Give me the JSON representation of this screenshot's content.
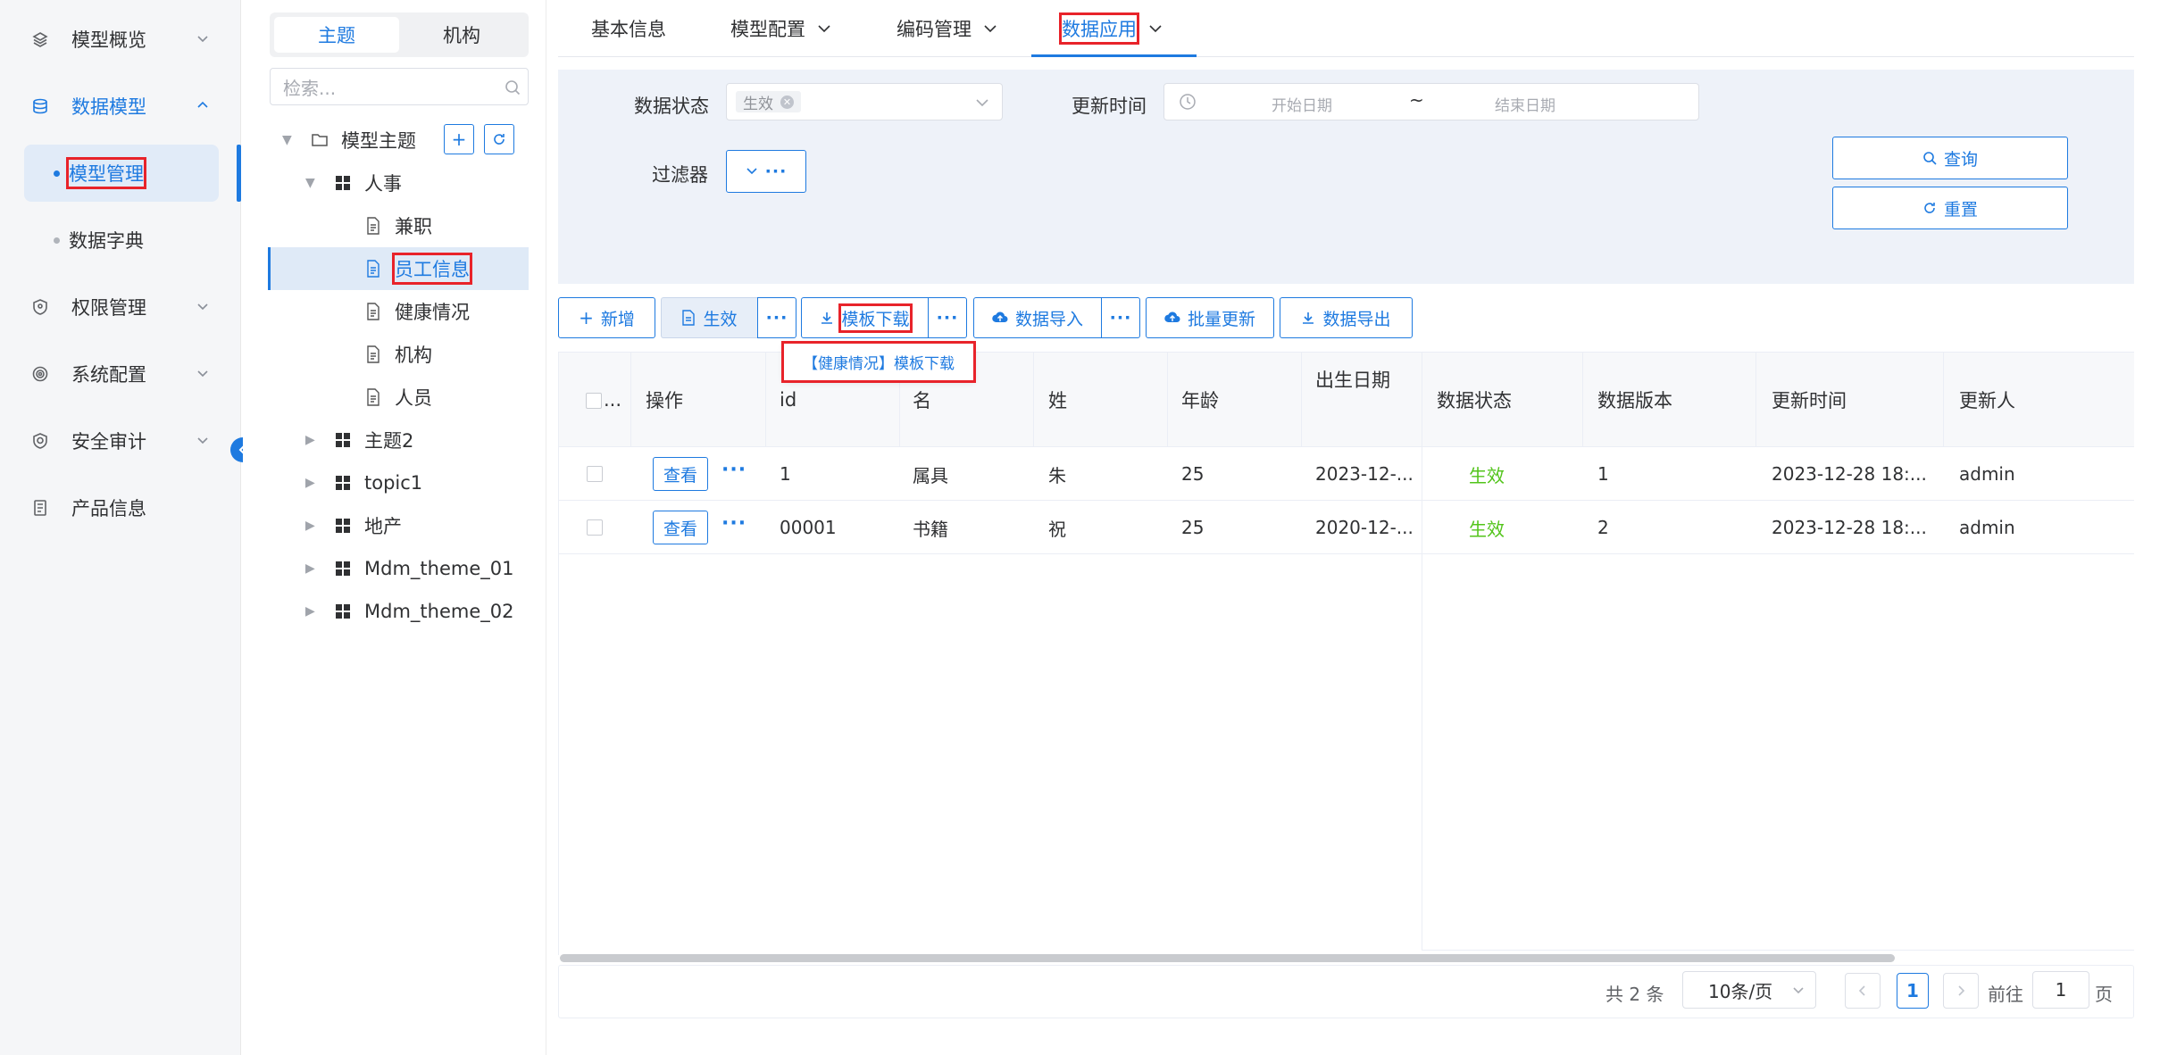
{
  "sidebar": {
    "items": [
      {
        "label": "模型概览",
        "icon": "layers-icon"
      },
      {
        "label": "数据模型",
        "icon": "database-icon"
      },
      {
        "label": "权限管理",
        "icon": "shield-icon"
      },
      {
        "label": "系统配置",
        "icon": "settings-icon"
      },
      {
        "label": "安全审计",
        "icon": "shield-check-icon"
      },
      {
        "label": "产品信息",
        "icon": "document-icon"
      }
    ],
    "subitems": [
      {
        "label": "模型管理"
      },
      {
        "label": "数据字典"
      }
    ]
  },
  "tree": {
    "tabs": [
      "主题",
      "机构"
    ],
    "search_placeholder": "检索...",
    "root": "模型主题",
    "nodes": {
      "renshi": "人事",
      "jianzhi": "兼职",
      "yuangong": "员工信息",
      "jiankang": "健康情况",
      "jigou": "机构",
      "renyuan": "人员",
      "zhuti2": "主题2",
      "topic1": "topic1",
      "dichan": "地产",
      "mdm1": "Mdm_theme_01",
      "mdm2": "Mdm_theme_02"
    }
  },
  "top_tabs": [
    "基本信息",
    "模型配置",
    "编码管理",
    "数据应用"
  ],
  "filter": {
    "status_label": "数据状态",
    "status_tag": "生效",
    "time_label": "更新时间",
    "start_placeholder": "开始日期",
    "range_sep": "~",
    "end_placeholder": "结束日期",
    "filter_label": "过滤器",
    "query_btn": "查询",
    "reset_btn": "重置"
  },
  "toolbar": {
    "add": "新增",
    "activate": "生效",
    "template_download": "模板下载",
    "import": "数据导入",
    "batch_update": "批量更新",
    "export": "数据导出",
    "tooltip": "【健康情况】模板下载"
  },
  "table": {
    "headers": [
      "...",
      "操作",
      "id",
      "名",
      "姓",
      "年龄",
      "出生日期",
      "数据状态",
      "数据版本",
      "更新时间",
      "更新人"
    ],
    "view_label": "查看",
    "rows": [
      {
        "id": "1",
        "ming": "属具",
        "xing": "朱",
        "age": "25",
        "birth": "2023-12-...",
        "status": "生效",
        "version": "1",
        "updated": "2023-12-28 18:...",
        "user": "admin"
      },
      {
        "id": "00001",
        "ming": "书籍",
        "xing": "祝",
        "age": "25",
        "birth": "2020-12-...",
        "status": "生效",
        "version": "2",
        "updated": "2023-12-28 18:...",
        "user": "admin"
      }
    ]
  },
  "pager": {
    "total": "共 2 条",
    "page_size": "10条/页",
    "current": "1",
    "goto_label": "前往",
    "goto_value": "1",
    "page_unit": "页"
  },
  "colors": {
    "accent": "#1e7ae0",
    "success": "#52c41a",
    "highlight": "#e8232a"
  }
}
